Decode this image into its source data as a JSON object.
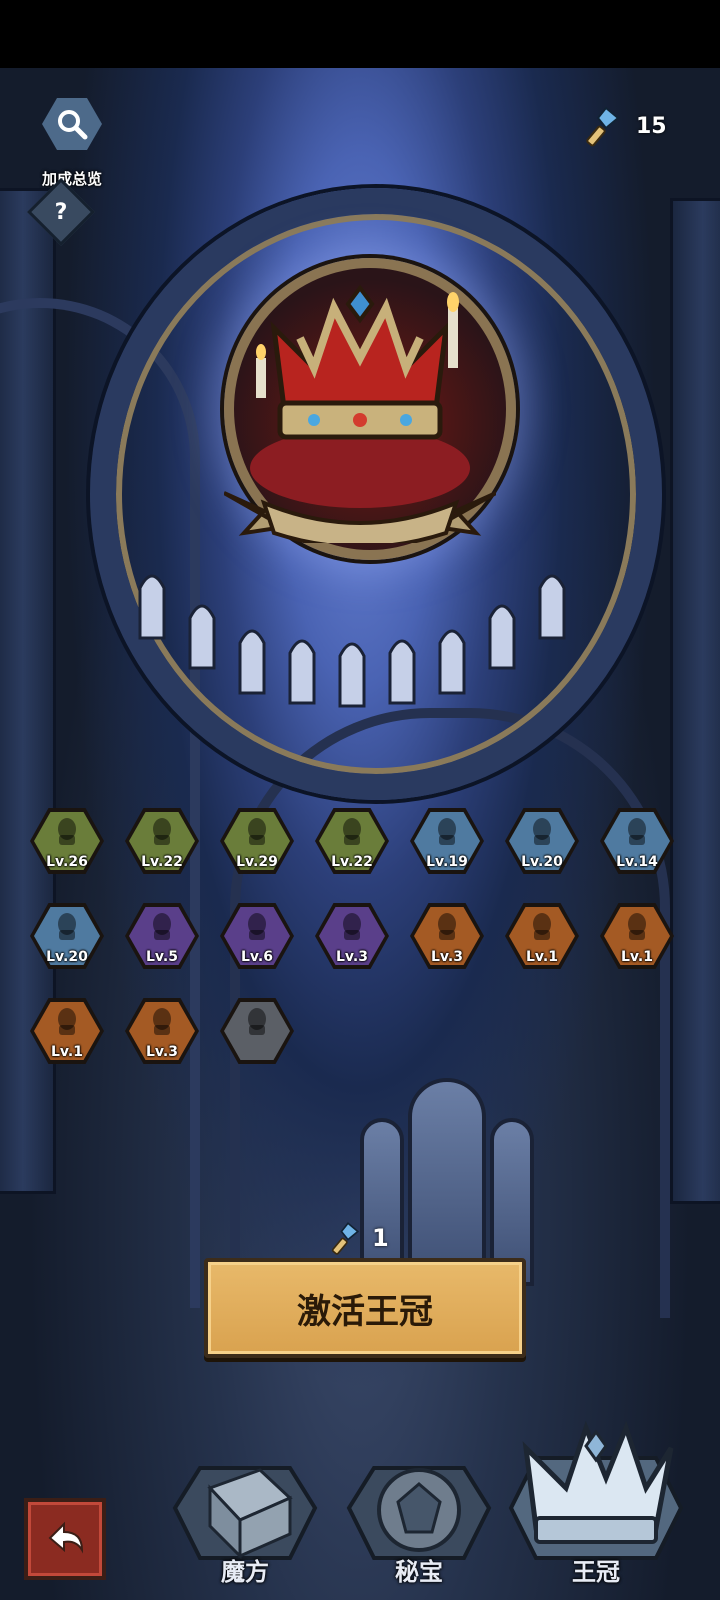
{
  "top": {
    "bonus_overview_label": "加成总览",
    "help_label": "?",
    "currency_value": "15",
    "currency_icon": "gem-key-icon"
  },
  "crown_panel": {
    "image_name": "crown-icon"
  },
  "crowns": [
    {
      "level": "Lv.26",
      "color": "#6a7d3a",
      "icon": "silhouette-person-icon"
    },
    {
      "level": "Lv.22",
      "color": "#6a7d3a",
      "icon": "bone-icon"
    },
    {
      "level": "Lv.29",
      "color": "#6a7d3a",
      "icon": "hat-figure-icon"
    },
    {
      "level": "Lv.22",
      "color": "#6a7d3a",
      "icon": "ghost-icon"
    },
    {
      "level": "Lv.19",
      "color": "#4f7aa0",
      "icon": "rabbit-icon"
    },
    {
      "level": "Lv.20",
      "color": "#4f7aa0",
      "icon": "helmet-icon"
    },
    {
      "level": "Lv.14",
      "color": "#4f7aa0",
      "icon": "beetle-icon"
    },
    {
      "level": "Lv.20",
      "color": "#4f7aa0",
      "icon": "claw-icon"
    },
    {
      "level": "Lv.5",
      "color": "#5a3f8a",
      "icon": "horned-helmet-icon"
    },
    {
      "level": "Lv.6",
      "color": "#5a3f8a",
      "icon": "witch-hat-icon"
    },
    {
      "level": "Lv.3",
      "color": "#5a3f8a",
      "icon": "fox-icon"
    },
    {
      "level": "Lv.3",
      "color": "#a45a24",
      "icon": "octopus-icon"
    },
    {
      "level": "Lv.1",
      "color": "#a45a24",
      "icon": "flame-icon"
    },
    {
      "level": "Lv.1",
      "color": "#a45a24",
      "icon": "chick-icon"
    },
    {
      "level": "Lv.1",
      "color": "#a45a24",
      "icon": "demon-icon"
    },
    {
      "level": "Lv.3",
      "color": "#a45a24",
      "icon": "king-icon"
    },
    {
      "level": "",
      "color": "#5b5f66",
      "icon": "locked-creature-icon"
    }
  ],
  "activate": {
    "cost_value": "1",
    "button_label": "激活王冠"
  },
  "nav": {
    "tab_cube": "魔方",
    "tab_treasure": "秘宝",
    "tab_crown": "王冠"
  }
}
